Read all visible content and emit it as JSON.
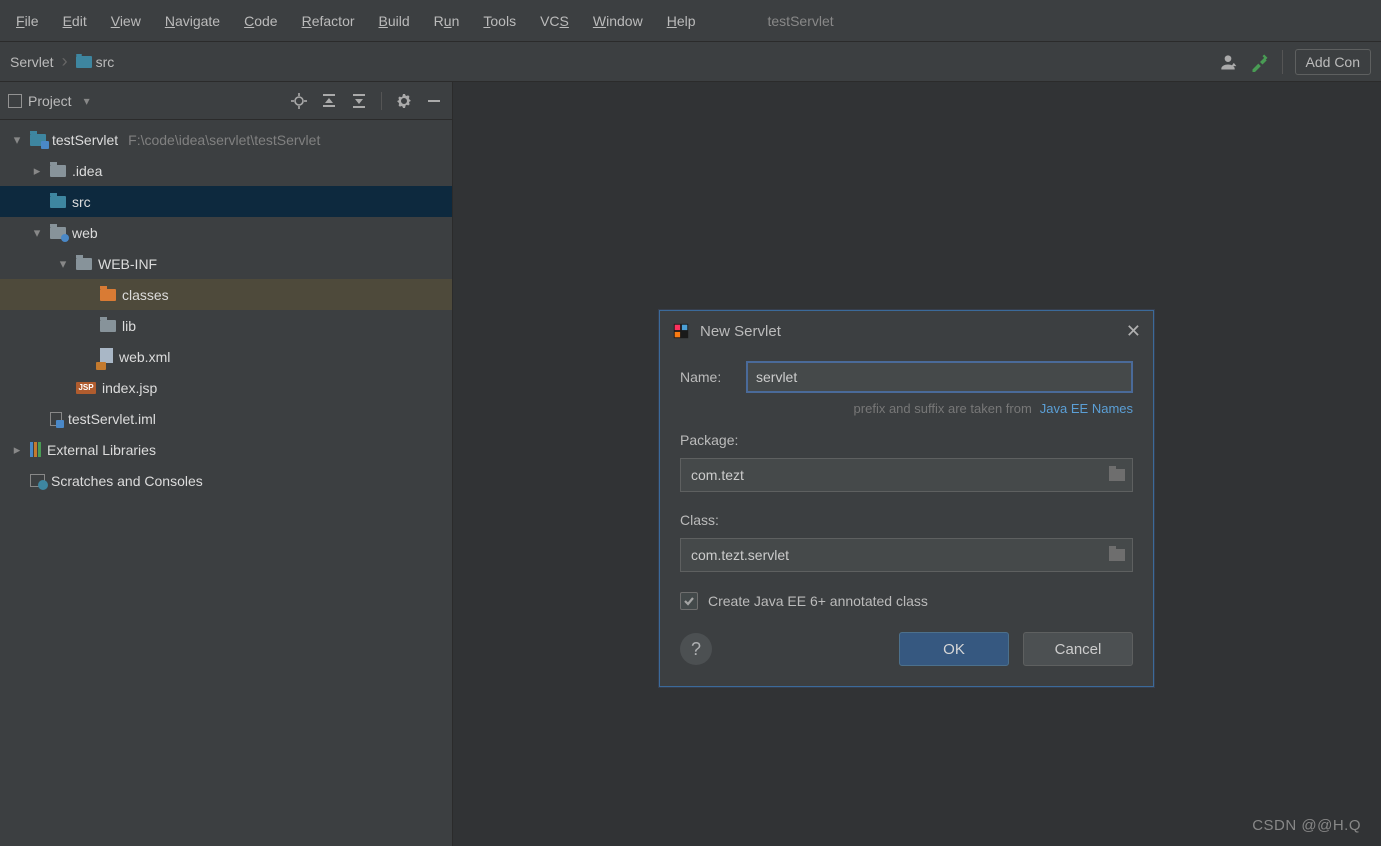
{
  "menu": {
    "file": "File",
    "edit": "Edit",
    "view": "View",
    "navigate": "Navigate",
    "code": "Code",
    "refactor": "Refactor",
    "build": "Build",
    "run": "Run",
    "tools": "Tools",
    "vcs": "VCS",
    "window": "Window",
    "help": "Help"
  },
  "window_title": "testServlet",
  "breadcrumb": {
    "root": "Servlet",
    "item2": "src"
  },
  "toolbar_right": {
    "add_config": "Add Con"
  },
  "sidebar": {
    "header": "Project",
    "tree": {
      "project": {
        "name": "testServlet",
        "path": "F:\\code\\idea\\servlet\\testServlet"
      },
      "idea_folder": ".idea",
      "src_folder": "src",
      "web_folder": "web",
      "webinf_folder": "WEB-INF",
      "classes_folder": "classes",
      "lib_folder": "lib",
      "webxml": "web.xml",
      "index_jsp": "index.jsp",
      "jsp_badge": "JSP",
      "iml": "testServlet.iml",
      "external_libs": "External Libraries",
      "scratches": "Scratches and Consoles"
    }
  },
  "dialog": {
    "title": "New Servlet",
    "name_label": "Name:",
    "name_value": "servlet",
    "hint_text": "prefix and suffix are taken from",
    "hint_link": "Java EE Names",
    "package_label": "Package:",
    "package_value": "com.tezt",
    "class_label": "Class:",
    "class_value": "com.tezt.servlet",
    "checkbox_label": "Create Java EE 6+ annotated class",
    "checkbox_checked": true,
    "ok": "OK",
    "cancel": "Cancel"
  },
  "watermark": "CSDN @@H.Q"
}
